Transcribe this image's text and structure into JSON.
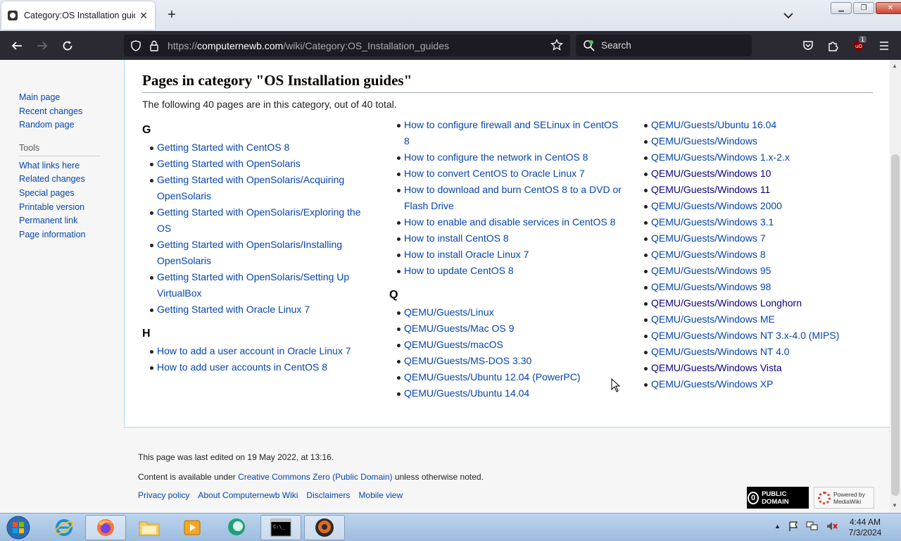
{
  "browser": {
    "tab_title": "Category:OS Installation guides",
    "url_scheme": "https://",
    "url_domain": "computernewb.com",
    "url_path": "/wiki/Category:OS_Installation_guides",
    "search_placeholder": "Search",
    "extension_badge": "1"
  },
  "sidebar": {
    "nav": [
      "Main page",
      "Recent changes",
      "Random page"
    ],
    "tools_heading": "Tools",
    "tools": [
      "What links here",
      "Related changes",
      "Special pages",
      "Printable version",
      "Permanent link",
      "Page information"
    ]
  },
  "page": {
    "heading": "Pages in category \"OS Installation guides\"",
    "intro": "The following 40 pages are in this category, out of 40 total."
  },
  "columns": {
    "col1": [
      {
        "letter": "G",
        "items": [
          "Getting Started with CentOS 8",
          "Getting Started with OpenSolaris",
          "Getting Started with OpenSolaris/Acquiring OpenSolaris",
          "Getting Started with OpenSolaris/Exploring the OS",
          "Getting Started with OpenSolaris/Installing OpenSolaris",
          "Getting Started with OpenSolaris/Setting Up VirtualBox",
          "Getting Started with Oracle Linux 7"
        ]
      },
      {
        "letter": "H",
        "items": [
          "How to add a user account in Oracle Linux 7",
          "How to add user accounts in CentOS 8"
        ]
      }
    ],
    "col2a": [
      "How to configure firewall and SELinux in CentOS 8",
      "How to configure the network in CentOS 8",
      "How to convert CentOS to Oracle Linux 7",
      "How to download and burn CentOS 8 to a DVD or Flash Drive",
      "How to enable and disable services in CentOS 8",
      "How to install CentOS 8",
      "How to install Oracle Linux 7",
      "How to update CentOS 8"
    ],
    "col2b": {
      "letter": "Q",
      "items": [
        "QEMU/Guests/Linux",
        "QEMU/Guests/Mac OS 9",
        "QEMU/Guests/macOS",
        "QEMU/Guests/MS-DOS 3.30",
        "QEMU/Guests/Ubuntu 12.04 (PowerPC)",
        "QEMU/Guests/Ubuntu 14.04"
      ]
    },
    "col3": [
      "QEMU/Guests/Ubuntu 16.04",
      "QEMU/Guests/Windows",
      "QEMU/Guests/Windows 1.x-2.x",
      "QEMU/Guests/Windows 10",
      "QEMU/Guests/Windows 11",
      "QEMU/Guests/Windows 2000",
      "QEMU/Guests/Windows 3.1",
      "QEMU/Guests/Windows 7",
      "QEMU/Guests/Windows 8",
      "QEMU/Guests/Windows 95",
      "QEMU/Guests/Windows 98",
      "QEMU/Guests/Windows Longhorn",
      "QEMU/Guests/Windows ME",
      "QEMU/Guests/Windows NT 3.x-4.0 (MIPS)",
      "QEMU/Guests/Windows NT 4.0",
      "QEMU/Guests/Windows Vista",
      "QEMU/Guests/Windows XP"
    ],
    "col3_visited": [
      3,
      4,
      11,
      15
    ]
  },
  "footer": {
    "last_edited": "This page was last edited on 19 May 2022, at 13:16.",
    "license_pre": "Content is available under ",
    "license_link": "Creative Commons Zero (Public Domain)",
    "license_post": " unless otherwise noted.",
    "links": [
      "Privacy policy",
      "About Computernewb Wiki",
      "Disclaimers",
      "Mobile view"
    ],
    "badge_pd": "PUBLIC DOMAIN",
    "badge_mw": "Powered by MediaWiki"
  },
  "taskbar": {
    "time": "4:44 AM",
    "date": "7/3/2024"
  }
}
